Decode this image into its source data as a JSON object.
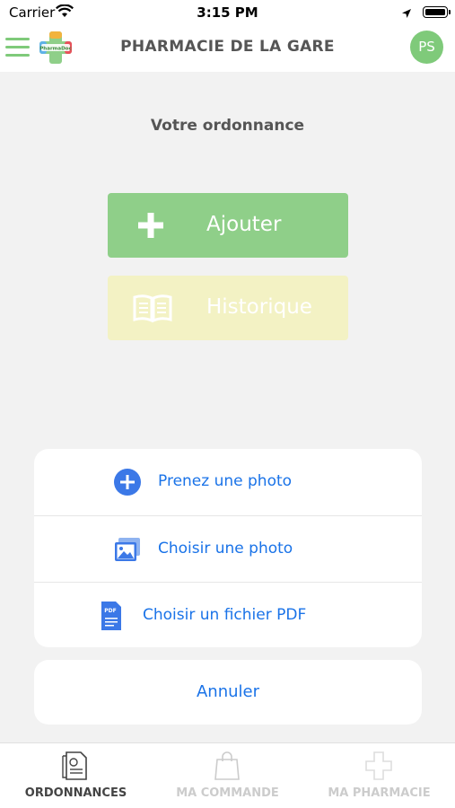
{
  "status_bar": {
    "carrier": "Carrier",
    "time": "3:15 PM"
  },
  "header": {
    "title": "PHARMACIE DE LA GARE",
    "avatar_initials": "PS",
    "logo_text": "PharmaDoc"
  },
  "main": {
    "subtitle": "Votre ordonnance",
    "add_label": "Ajouter",
    "history_label": "Historique"
  },
  "action_sheet": {
    "options": [
      {
        "label": "Prenez une photo",
        "icon": "plus-circle-icon"
      },
      {
        "label": "Choisir une photo",
        "icon": "photos-icon"
      },
      {
        "label": "Choisir un fichier PDF",
        "icon": "pdf-file-icon"
      }
    ],
    "pdf_icon_text": "PDF",
    "cancel_label": "Annuler"
  },
  "tabs": [
    {
      "label": "ORDONNANCES",
      "icon": "prescription-icon",
      "active": true
    },
    {
      "label": "MA COMMANDE",
      "icon": "shopping-bag-icon",
      "active": false
    },
    {
      "label": "MA PHARMACIE",
      "icon": "pharmacy-cross-icon",
      "active": false
    }
  ],
  "colors": {
    "brand_green": "#7fca7a",
    "add_button": "#8fcf89",
    "history_button": "#f3f2c4",
    "link_blue": "#1a73e8",
    "tab_active": "#444444",
    "tab_inactive": "#cccccc"
  }
}
